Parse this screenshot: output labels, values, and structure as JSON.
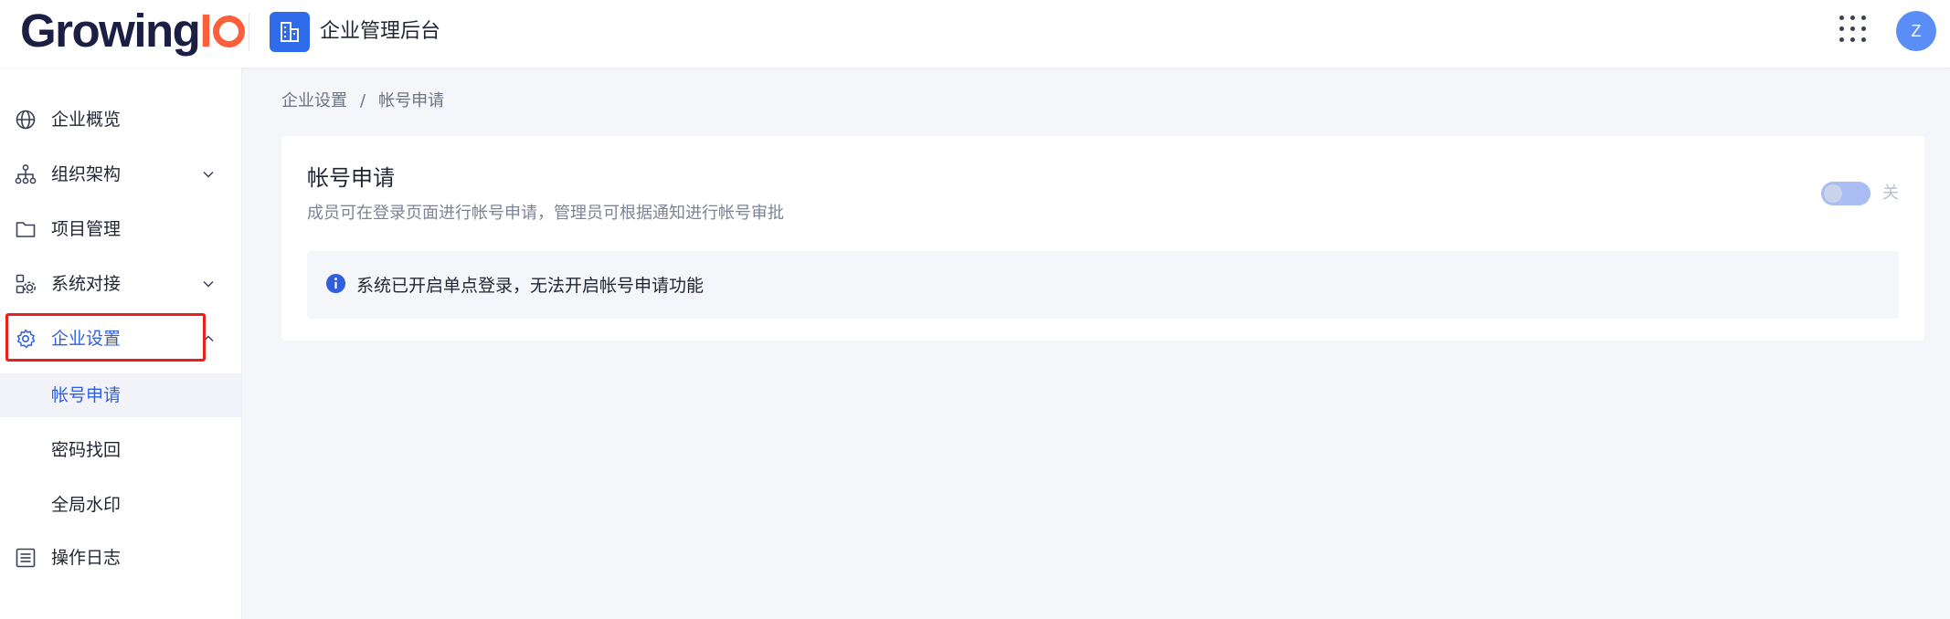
{
  "header": {
    "logo_main": "Growing",
    "logo_accent": "I",
    "app_title": "企业管理后台",
    "avatar_initial": "Z",
    "icons": [
      "building-icon",
      "apps-grid-icon"
    ]
  },
  "sidebar": {
    "items": [
      {
        "label": "企业概览",
        "icon": "globe-icon"
      },
      {
        "label": "组织架构",
        "icon": "org-chart-icon"
      },
      {
        "label": "项目管理",
        "icon": "folder-icon"
      },
      {
        "label": "系统对接",
        "icon": "integration-gear-icon"
      },
      {
        "label": "企业设置",
        "icon": "gear-icon"
      },
      {
        "label": "操作日志",
        "icon": "log-list-icon"
      }
    ],
    "sub_items": [
      {
        "label": "帐号申请"
      },
      {
        "label": "密码找回"
      },
      {
        "label": "全局水印"
      }
    ]
  },
  "breadcrumb": {
    "parent": "企业设置",
    "separator": "/",
    "current": "帐号申请"
  },
  "card": {
    "title": "帐号申请",
    "description": "成员可在登录页面进行帐号申请，管理员可根据通知进行帐号审批",
    "toggle_state_label": "关",
    "notice": "系统已开启单点登录，无法开启帐号申请功能"
  },
  "colors": {
    "accent": "#2f5fe0",
    "logo_orange": "#fc5f3a",
    "highlight_box": "#e8221a",
    "toggle_off": "#a9bdf2"
  }
}
